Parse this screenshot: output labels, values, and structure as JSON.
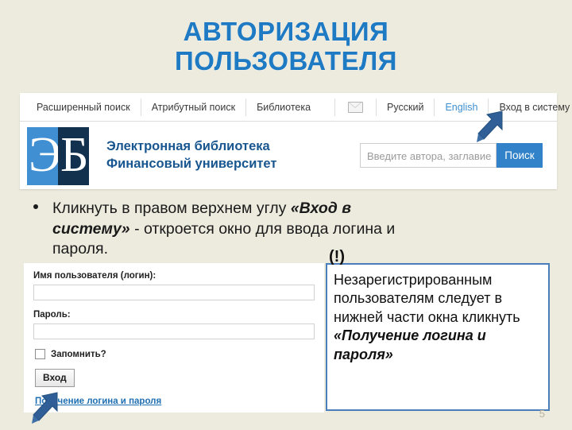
{
  "slide": {
    "title_line1": "АВТОРИЗАЦИЯ",
    "title_line2": "ПОЛЬЗОВАТЕЛЯ",
    "number": "5",
    "accent_color": "#1f7ac4",
    "background_color": "#edeade"
  },
  "site": {
    "topnav": {
      "items": [
        {
          "label": "Расширенный поиск"
        },
        {
          "label": "Атрибутный поиск"
        },
        {
          "label": "Библиотека"
        },
        {
          "label": "Русский"
        },
        {
          "label": "English"
        },
        {
          "label": "Вход в систему"
        }
      ],
      "mail_icon": "envelope-icon",
      "english_link_color": "#3d8fd0"
    },
    "brand": {
      "logo_left_letter": "Э",
      "logo_right_letter": "Б",
      "logo_left_color": "#3f8fd2",
      "logo_right_color": "#11314f",
      "name_line1": "Электронная библиотека",
      "name_line2": "Финансовый университет",
      "name_color": "#18568f"
    },
    "search": {
      "placeholder": "Введите автора, заглавие",
      "button_label": "Поиск",
      "button_color": "#3182c9"
    }
  },
  "bullet": {
    "part1": "Кликнуть в правом верхнем углу ",
    "emphasis": "«Вход в систему»",
    "part2": " - откроется окно для ввода логина и пароля."
  },
  "login_form": {
    "username_label": "Имя пользователя (логин):",
    "username_value": "",
    "password_label": "Пароль:",
    "password_value": "",
    "remember_label": "Запомнить?",
    "submit_label": "Вход",
    "get_credentials_link": "Получение логина и пароля",
    "link_color": "#1f6fb2"
  },
  "callout": {
    "marker": "(!)",
    "part1": "Незарегистрированным пользователям следует в нижней части окна кликнуть ",
    "emphasis": "«Получение логина и пароля»",
    "border_color": "#4a7ebb"
  },
  "arrows": {
    "to_login_link": "arrow-up-right-icon",
    "to_get_credentials": "arrow-up-right-icon",
    "color": "#2f5f96"
  }
}
